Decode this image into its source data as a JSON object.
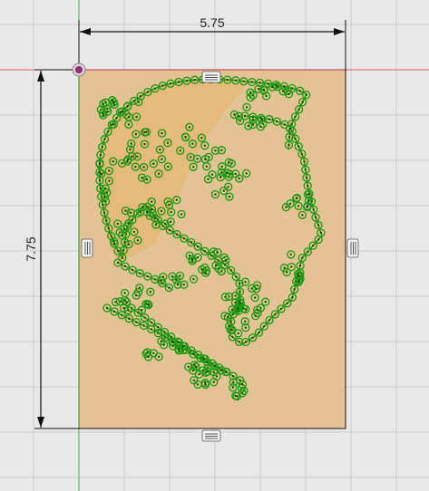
{
  "sketch": {
    "width_dimension": "5.75",
    "height_dimension": "7.75"
  },
  "colors": {
    "canvas_background": "#e9e9e9",
    "grid_line": "#cccccc",
    "plate_fill": "#e3c394",
    "region_fill": "#e7b66e",
    "sketch_curve": "#2f8d12",
    "sketch_point": "#1b9a12",
    "dimension_line": "#111111",
    "x_axis": "#d9586b",
    "y_axis": "#2fc12f",
    "origin_point": "#9b2b78"
  },
  "icons": {
    "constraint_glyph": "horizontal-vertical-constraint-icon",
    "origin_glyph": "origin-point-icon"
  }
}
